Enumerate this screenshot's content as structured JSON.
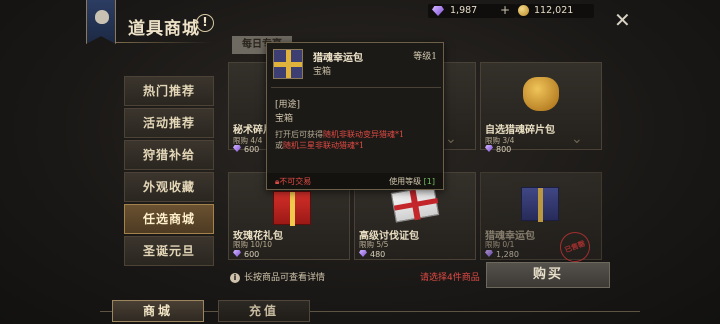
{
  "header": {
    "title": "道具商城",
    "help_symbol": "!"
  },
  "currency": {
    "gems": "1,987",
    "plus": "+",
    "coins": "112,021"
  },
  "sidebar": {
    "items": [
      {
        "label": "热门推荐"
      },
      {
        "label": "活动推荐"
      },
      {
        "label": "狩猎补给"
      },
      {
        "label": "外观收藏"
      },
      {
        "label": "任选商城"
      },
      {
        "label": "圣诞元旦"
      }
    ]
  },
  "daily_tab": "每日专享",
  "cards": [
    {
      "name": "秘术碎片",
      "limit": "限购 4/4",
      "price": "600"
    },
    {
      "name": "",
      "limit": "",
      "price": ""
    },
    {
      "name": "自选猎魂碎片包",
      "limit": "限购 3/4",
      "price": "800"
    },
    {
      "name": "玫瑰花礼包",
      "limit": "限购 10/10",
      "price": "600"
    },
    {
      "name": "高级讨伐证包",
      "limit": "限购 5/5",
      "price": "480"
    },
    {
      "name": "猎魂幸运包",
      "limit": "限购 0/1",
      "price": "1,280"
    }
  ],
  "sold_out_stamp": "已售罄",
  "tooltip": {
    "name": "猎魂幸运包",
    "type": "宝箱",
    "level": "等级1",
    "usage_header": "[用途]",
    "usage_type": "宝箱",
    "desc_1": "打开后可获得",
    "desc_red_1": "随机非联动变异猎魂",
    "desc_2": "*1",
    "desc_3": "或",
    "desc_red_2": "随机三星非联动猎魂",
    "desc_4": "*1",
    "tradable": "不可交易",
    "use_level_label": "使用等级",
    "use_level_value": "[1]"
  },
  "footer": {
    "hint": "长按商品可查看详情",
    "select_hint": "请选择4件商品",
    "buy_label": "购买"
  },
  "bottom_tabs": [
    {
      "label": "商城"
    },
    {
      "label": "充值"
    }
  ]
}
